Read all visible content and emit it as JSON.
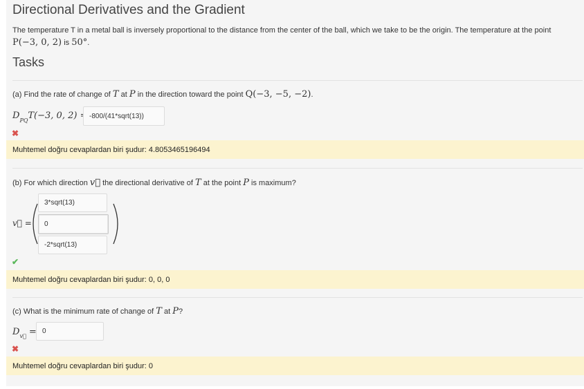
{
  "title": "Directional Derivatives and the Gradient",
  "intro": {
    "line1": "The temperature T in a metal ball is inversely proportional to the distance from the center of the ball, which we take to be the origin. The temperature at the point",
    "point": "P(−3, 0, 2)",
    "is": " is ",
    "temp": "50°",
    "end": "."
  },
  "tasks_heading": "Tasks",
  "parts": {
    "a": {
      "question_pre": "(a) Find the rate of change of ",
      "T": "T",
      "at": " at ",
      "P": "P",
      "question_mid": " in the direction toward the point ",
      "Q": "Q(−3, −5, −2)",
      "dot": ".",
      "lhs": "D",
      "lhs_sub": "PQ",
      "lhs_rest": "T(−3, 0, 2) =",
      "answer_value": "-800/(41*sqrt(13))",
      "mark": "✖",
      "feedback": "Muhtemel doğru cevaplardan biri şudur: 4.8053465196494"
    },
    "b": {
      "question_pre": "(b) For which direction ",
      "v": "v⃗",
      "question_mid": " the directional derivative of ",
      "T": "T",
      "at": " at the point ",
      "P": "P",
      "question_end": " is maximum?",
      "lhs": "v⃗ =",
      "answers": [
        "3*sqrt(13)",
        "0",
        "-2*sqrt(13)"
      ],
      "mark": "✔",
      "feedback": "Muhtemel doğru cevaplardan biri şudur: 0, 0, 0"
    },
    "c": {
      "question_pre": "(c) What is the minimum rate of change of ",
      "T": "T",
      "at": " at ",
      "P": "P",
      "question_end": "?",
      "lhs": "D",
      "lhs_sub": "v⃗",
      "lhs_rest": " =",
      "answer_value": "0",
      "mark": "✖",
      "feedback": "Muhtemel doğru cevaplardan biri şudur: 0"
    }
  },
  "colors": {
    "panel": "#f5f5f5",
    "feedback_bg": "#fcf3cf",
    "wrong": "#d9534f",
    "correct": "#5cb85c"
  }
}
